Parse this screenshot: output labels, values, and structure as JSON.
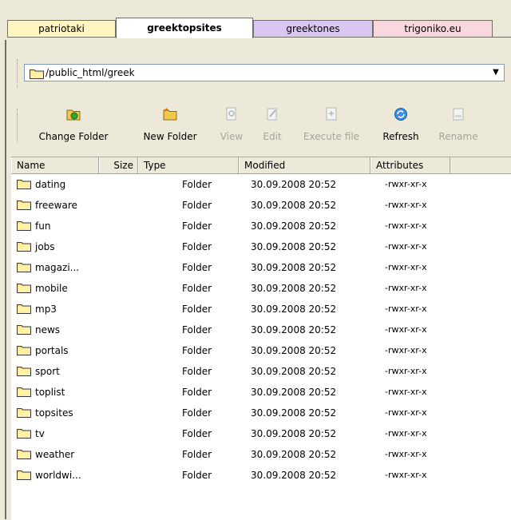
{
  "tabs": [
    {
      "label": "patriotaki",
      "color": "#fff6c2",
      "active": false
    },
    {
      "label": "greektopsites",
      "color": "#ffffff",
      "active": true
    },
    {
      "label": "greektones",
      "color": "#d9c7f1",
      "active": false
    },
    {
      "label": "trigoniko.eu",
      "color": "#f9d7de",
      "active": false
    }
  ],
  "path": {
    "value": "/public_html/greek"
  },
  "toolbar": {
    "change_folder": "Change Folder",
    "new_folder": "New Folder",
    "view": "View",
    "edit": "Edit",
    "execute_file": "Execute file",
    "refresh": "Refresh",
    "rename": "Rename"
  },
  "columns": {
    "name": "Name",
    "size": "Size",
    "type": "Type",
    "modified": "Modified",
    "attributes": "Attributes"
  },
  "files": [
    {
      "name": "dating",
      "type": "Folder",
      "modified": "30.09.2008 20:52",
      "attributes": "-rwxr-xr-x"
    },
    {
      "name": "freeware",
      "type": "Folder",
      "modified": "30.09.2008 20:52",
      "attributes": "-rwxr-xr-x"
    },
    {
      "name": "fun",
      "type": "Folder",
      "modified": "30.09.2008 20:52",
      "attributes": "-rwxr-xr-x"
    },
    {
      "name": "jobs",
      "type": "Folder",
      "modified": "30.09.2008 20:52",
      "attributes": "-rwxr-xr-x"
    },
    {
      "name": "magazi...",
      "type": "Folder",
      "modified": "30.09.2008 20:52",
      "attributes": "-rwxr-xr-x"
    },
    {
      "name": "mobile",
      "type": "Folder",
      "modified": "30.09.2008 20:52",
      "attributes": "-rwxr-xr-x"
    },
    {
      "name": "mp3",
      "type": "Folder",
      "modified": "30.09.2008 20:52",
      "attributes": "-rwxr-xr-x"
    },
    {
      "name": "news",
      "type": "Folder",
      "modified": "30.09.2008 20:52",
      "attributes": "-rwxr-xr-x"
    },
    {
      "name": "portals",
      "type": "Folder",
      "modified": "30.09.2008 20:52",
      "attributes": "-rwxr-xr-x"
    },
    {
      "name": "sport",
      "type": "Folder",
      "modified": "30.09.2008 20:52",
      "attributes": "-rwxr-xr-x"
    },
    {
      "name": "toplist",
      "type": "Folder",
      "modified": "30.09.2008 20:52",
      "attributes": "-rwxr-xr-x"
    },
    {
      "name": "topsites",
      "type": "Folder",
      "modified": "30.09.2008 20:52",
      "attributes": "-rwxr-xr-x"
    },
    {
      "name": "tv",
      "type": "Folder",
      "modified": "30.09.2008 20:52",
      "attributes": "-rwxr-xr-x"
    },
    {
      "name": "weather",
      "type": "Folder",
      "modified": "30.09.2008 20:52",
      "attributes": "-rwxr-xr-x"
    },
    {
      "name": "worldwi...",
      "type": "Folder",
      "modified": "30.09.2008 20:52",
      "attributes": "-rwxr-xr-x"
    }
  ]
}
